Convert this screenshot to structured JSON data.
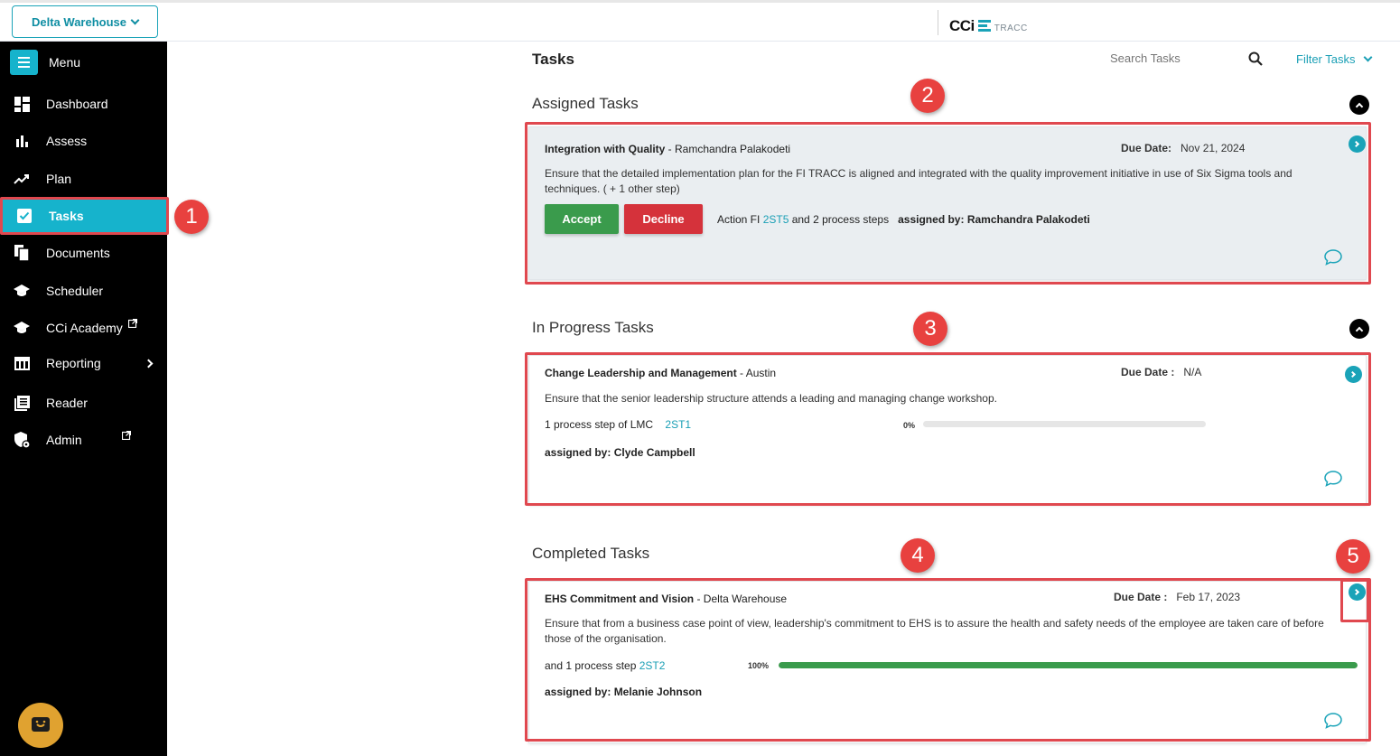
{
  "header": {
    "workspace": "Delta Warehouse",
    "logo_main": "CCi",
    "logo_sub": "TRACC"
  },
  "sidebar": {
    "menu_label": "Menu",
    "items": [
      {
        "label": "Dashboard",
        "icon": "dashboard-icon"
      },
      {
        "label": "Assess",
        "icon": "bar-chart-icon"
      },
      {
        "label": "Plan",
        "icon": "trend-icon"
      },
      {
        "label": "Tasks",
        "icon": "checkbox-icon",
        "active": true
      },
      {
        "label": "Documents",
        "icon": "documents-icon"
      },
      {
        "label": "Scheduler",
        "icon": "scheduler-icon"
      },
      {
        "label": "CCi Academy",
        "icon": "academy-icon",
        "external": true
      },
      {
        "label": "Reporting",
        "icon": "table-icon",
        "has_submenu": true
      },
      {
        "label": "Reader",
        "icon": "reader-icon"
      },
      {
        "label": "Admin",
        "icon": "admin-shield-icon",
        "external": true
      }
    ]
  },
  "main": {
    "title": "Tasks",
    "search_placeholder": "Search Tasks",
    "filter_label": "Filter Tasks",
    "sections": {
      "assigned": {
        "title": "Assigned Tasks",
        "task": {
          "name": "Integration with Quality",
          "owner": " - Ramchandra Palakodeti",
          "due_label": "Due Date:",
          "due_value": "Nov 21, 2024",
          "description": "Ensure that the detailed implementation plan for the FI TRACC is aligned and integrated with the quality improvement initiative in use of Six Sigma tools and techniques. ( + 1 other step)",
          "accept_label": "Accept",
          "decline_label": "Decline",
          "action_prefix": "Action FI ",
          "action_link": "2ST5",
          "action_suffix": " and 2 process steps",
          "assigned_by": "assigned by: Ramchandra Palakodeti"
        }
      },
      "in_progress": {
        "title": "In Progress Tasks",
        "task": {
          "name": "Change Leadership and Management",
          "owner": " - Austin",
          "due_label": "Due Date :",
          "due_value": "N/A",
          "description": "Ensure that the senior leadership structure attends a leading and managing change workshop.",
          "step_text": "1 process step of LMC",
          "step_link": "2ST1",
          "progress_label": "0%",
          "progress": 0,
          "assigned_by": "assigned by: Clyde Campbell"
        }
      },
      "completed": {
        "title": "Completed Tasks",
        "task": {
          "name": "EHS Commitment and Vision",
          "owner": " - Delta Warehouse",
          "due_label": "Due Date :",
          "due_value": "Feb 17, 2023",
          "description": "Ensure that from a business case point of view, leadership's commitment to EHS is to assure the health and safety needs of the employee are taken care of before those of the organisation.",
          "step_text": "and 1 process step ",
          "step_link": "2ST2",
          "progress_label": "100%",
          "progress": 100,
          "assigned_by": "assigned by: Melanie Johnson"
        }
      }
    }
  },
  "annotations": [
    "1",
    "2",
    "3",
    "4",
    "5"
  ],
  "colors": {
    "accent": "#16b3cc",
    "sidebar_bg": "#000000",
    "accept": "#3a9b4c",
    "decline": "#d5323b",
    "highlight": "#e0484f",
    "badge": "#e8413f"
  }
}
